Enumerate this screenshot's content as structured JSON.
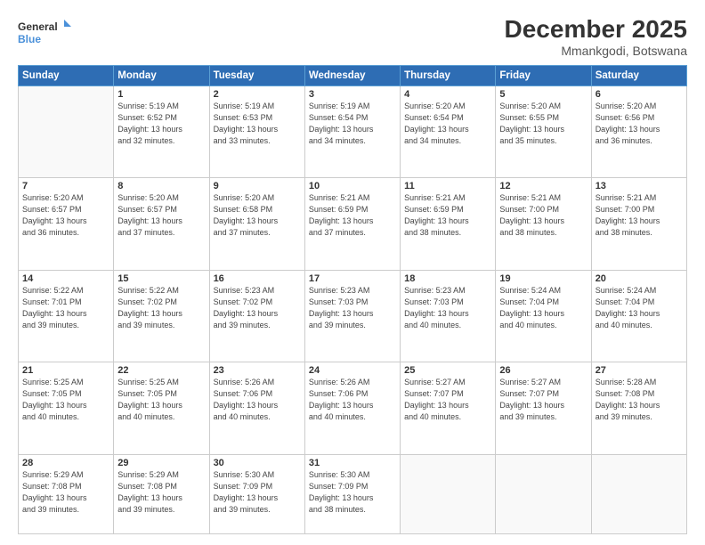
{
  "header": {
    "logo_line1": "General",
    "logo_line2": "Blue",
    "month_year": "December 2025",
    "location": "Mmankgodi, Botswana"
  },
  "days_of_week": [
    "Sunday",
    "Monday",
    "Tuesday",
    "Wednesday",
    "Thursday",
    "Friday",
    "Saturday"
  ],
  "weeks": [
    [
      {
        "day": "",
        "info": ""
      },
      {
        "day": "1",
        "info": "Sunrise: 5:19 AM\nSunset: 6:52 PM\nDaylight: 13 hours\nand 32 minutes."
      },
      {
        "day": "2",
        "info": "Sunrise: 5:19 AM\nSunset: 6:53 PM\nDaylight: 13 hours\nand 33 minutes."
      },
      {
        "day": "3",
        "info": "Sunrise: 5:19 AM\nSunset: 6:54 PM\nDaylight: 13 hours\nand 34 minutes."
      },
      {
        "day": "4",
        "info": "Sunrise: 5:20 AM\nSunset: 6:54 PM\nDaylight: 13 hours\nand 34 minutes."
      },
      {
        "day": "5",
        "info": "Sunrise: 5:20 AM\nSunset: 6:55 PM\nDaylight: 13 hours\nand 35 minutes."
      },
      {
        "day": "6",
        "info": "Sunrise: 5:20 AM\nSunset: 6:56 PM\nDaylight: 13 hours\nand 36 minutes."
      }
    ],
    [
      {
        "day": "7",
        "info": "Sunrise: 5:20 AM\nSunset: 6:57 PM\nDaylight: 13 hours\nand 36 minutes."
      },
      {
        "day": "8",
        "info": "Sunrise: 5:20 AM\nSunset: 6:57 PM\nDaylight: 13 hours\nand 37 minutes."
      },
      {
        "day": "9",
        "info": "Sunrise: 5:20 AM\nSunset: 6:58 PM\nDaylight: 13 hours\nand 37 minutes."
      },
      {
        "day": "10",
        "info": "Sunrise: 5:21 AM\nSunset: 6:59 PM\nDaylight: 13 hours\nand 37 minutes."
      },
      {
        "day": "11",
        "info": "Sunrise: 5:21 AM\nSunset: 6:59 PM\nDaylight: 13 hours\nand 38 minutes."
      },
      {
        "day": "12",
        "info": "Sunrise: 5:21 AM\nSunset: 7:00 PM\nDaylight: 13 hours\nand 38 minutes."
      },
      {
        "day": "13",
        "info": "Sunrise: 5:21 AM\nSunset: 7:00 PM\nDaylight: 13 hours\nand 38 minutes."
      }
    ],
    [
      {
        "day": "14",
        "info": "Sunrise: 5:22 AM\nSunset: 7:01 PM\nDaylight: 13 hours\nand 39 minutes."
      },
      {
        "day": "15",
        "info": "Sunrise: 5:22 AM\nSunset: 7:02 PM\nDaylight: 13 hours\nand 39 minutes."
      },
      {
        "day": "16",
        "info": "Sunrise: 5:23 AM\nSunset: 7:02 PM\nDaylight: 13 hours\nand 39 minutes."
      },
      {
        "day": "17",
        "info": "Sunrise: 5:23 AM\nSunset: 7:03 PM\nDaylight: 13 hours\nand 39 minutes."
      },
      {
        "day": "18",
        "info": "Sunrise: 5:23 AM\nSunset: 7:03 PM\nDaylight: 13 hours\nand 40 minutes."
      },
      {
        "day": "19",
        "info": "Sunrise: 5:24 AM\nSunset: 7:04 PM\nDaylight: 13 hours\nand 40 minutes."
      },
      {
        "day": "20",
        "info": "Sunrise: 5:24 AM\nSunset: 7:04 PM\nDaylight: 13 hours\nand 40 minutes."
      }
    ],
    [
      {
        "day": "21",
        "info": "Sunrise: 5:25 AM\nSunset: 7:05 PM\nDaylight: 13 hours\nand 40 minutes."
      },
      {
        "day": "22",
        "info": "Sunrise: 5:25 AM\nSunset: 7:05 PM\nDaylight: 13 hours\nand 40 minutes."
      },
      {
        "day": "23",
        "info": "Sunrise: 5:26 AM\nSunset: 7:06 PM\nDaylight: 13 hours\nand 40 minutes."
      },
      {
        "day": "24",
        "info": "Sunrise: 5:26 AM\nSunset: 7:06 PM\nDaylight: 13 hours\nand 40 minutes."
      },
      {
        "day": "25",
        "info": "Sunrise: 5:27 AM\nSunset: 7:07 PM\nDaylight: 13 hours\nand 40 minutes."
      },
      {
        "day": "26",
        "info": "Sunrise: 5:27 AM\nSunset: 7:07 PM\nDaylight: 13 hours\nand 39 minutes."
      },
      {
        "day": "27",
        "info": "Sunrise: 5:28 AM\nSunset: 7:08 PM\nDaylight: 13 hours\nand 39 minutes."
      }
    ],
    [
      {
        "day": "28",
        "info": "Sunrise: 5:29 AM\nSunset: 7:08 PM\nDaylight: 13 hours\nand 39 minutes."
      },
      {
        "day": "29",
        "info": "Sunrise: 5:29 AM\nSunset: 7:08 PM\nDaylight: 13 hours\nand 39 minutes."
      },
      {
        "day": "30",
        "info": "Sunrise: 5:30 AM\nSunset: 7:09 PM\nDaylight: 13 hours\nand 39 minutes."
      },
      {
        "day": "31",
        "info": "Sunrise: 5:30 AM\nSunset: 7:09 PM\nDaylight: 13 hours\nand 38 minutes."
      },
      {
        "day": "",
        "info": ""
      },
      {
        "day": "",
        "info": ""
      },
      {
        "day": "",
        "info": ""
      }
    ]
  ]
}
